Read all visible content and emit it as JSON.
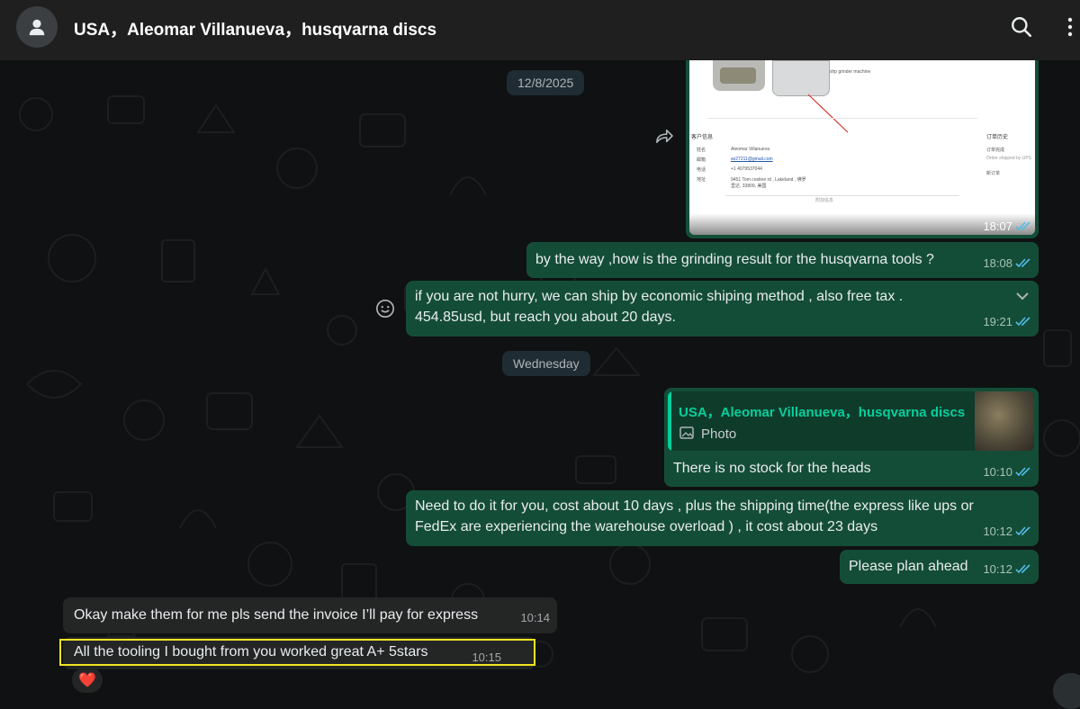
{
  "header": {
    "title": "USA，Aleomar Villanueva，husqvarna discs"
  },
  "dates": {
    "first": "12/8/2025",
    "second": "Wednesday"
  },
  "image_message": {
    "time": "18:07",
    "screenshot_text": {
      "machine": "shp grinder machine",
      "customer_header": "客户信息",
      "name_label": "姓名",
      "name": "Aleomar Villanueva",
      "email_label": "邮箱",
      "email": "av27211@gmail.com",
      "phone_label": "电话",
      "phone": "+1 4079537044",
      "address_label": "地址",
      "address": "9451 Tom costine rd , Lakeland , 佛罗",
      "address2": "里达, 33809, 美国",
      "more": "附加信息",
      "order_history": "订单历史",
      "order_created": "订单完成",
      "order_note": "Order shipped by UPS",
      "new_order": "新订单"
    }
  },
  "messages": [
    {
      "id": "m1",
      "text": "by the way ,how is the grinding result for the husqvarna tools ?",
      "time": "18:08"
    },
    {
      "id": "m2",
      "text": "if you are not hurry, we can ship by economic shiping method , also free tax .\n454.85usd, but reach you about 20 days.",
      "time": "19:21"
    },
    {
      "id": "m3",
      "text": "There is no stock for the heads",
      "time": "10:10",
      "quote": {
        "author": "USA，Aleomar Villanueva，husqvarna discs",
        "type": "Photo"
      }
    },
    {
      "id": "m4",
      "text": "Need to do it for you, cost about 10 days , plus the shipping time(the express like ups or\nFedEx are experiencing the warehouse overload ) , it cost about 23 days",
      "time": "10:12"
    },
    {
      "id": "m5",
      "text": "Please plan ahead",
      "time": "10:12"
    },
    {
      "id": "m6",
      "text": "Okay make them for me pls send the invoice I’ll pay for express",
      "time": "10:14"
    },
    {
      "id": "m7",
      "text": "All the tooling I bought from you worked great A+ 5stars",
      "time": "10:15"
    }
  ],
  "reaction": "❤️",
  "icons": {
    "avatar": "person-icon",
    "search": "search-icon",
    "menu": "kebab-menu-icon",
    "forward": "forward-icon",
    "emoji": "smiley-icon",
    "chevron": "chevron-down-icon",
    "read": "double-check-icon",
    "photo": "photo-icon"
  },
  "colors": {
    "outgoing": "#144d37",
    "incoming": "#242626",
    "accent": "#06cf9c",
    "read_tick": "#53bdeb",
    "highlight": "#f1e51f"
  }
}
